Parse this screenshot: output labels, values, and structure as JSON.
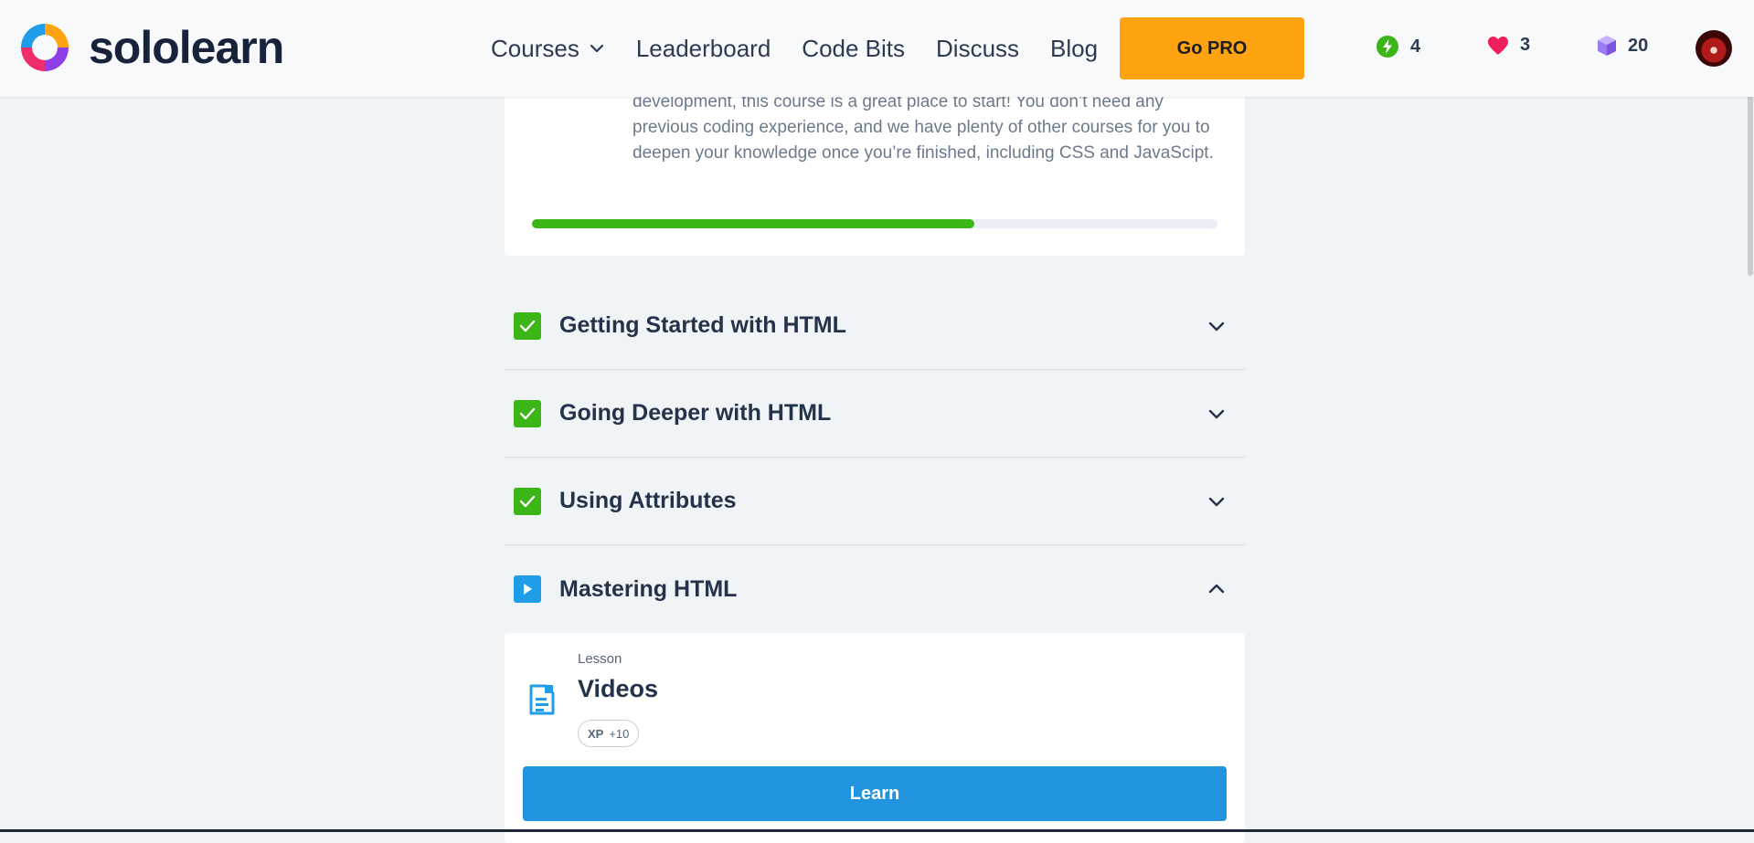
{
  "brand": {
    "name": "sololearn"
  },
  "nav": {
    "items": [
      "Courses",
      "Leaderboard",
      "Code Bits",
      "Discuss",
      "Blog"
    ],
    "go_pro_label": "Go PRO"
  },
  "stats": {
    "streak": "4",
    "hearts": "3",
    "bits": "20"
  },
  "course": {
    "description": "development, this course is a great place to start! You don’t need any previous coding experience, and we have plenty of other courses for you to deepen your knowledge once you’re finished, including CSS and JavaScipt.",
    "progress_fraction": 0.645
  },
  "modules": [
    {
      "title": "Getting Started with HTML",
      "status": "completed",
      "expanded": false
    },
    {
      "title": "Going Deeper with HTML",
      "status": "completed",
      "expanded": false
    },
    {
      "title": "Using Attributes",
      "status": "completed",
      "expanded": false
    },
    {
      "title": "Mastering HTML",
      "status": "in-progress",
      "expanded": true
    }
  ],
  "lesson": {
    "kicker": "Lesson",
    "title": "Videos",
    "xp_label": "XP",
    "xp_value": "+10",
    "action_label": "Learn"
  },
  "colors": {
    "accent_orange": "#ffa310",
    "success_green": "#3cb517",
    "primary_blue": "#2294df",
    "play_blue": "#1f9de8"
  }
}
